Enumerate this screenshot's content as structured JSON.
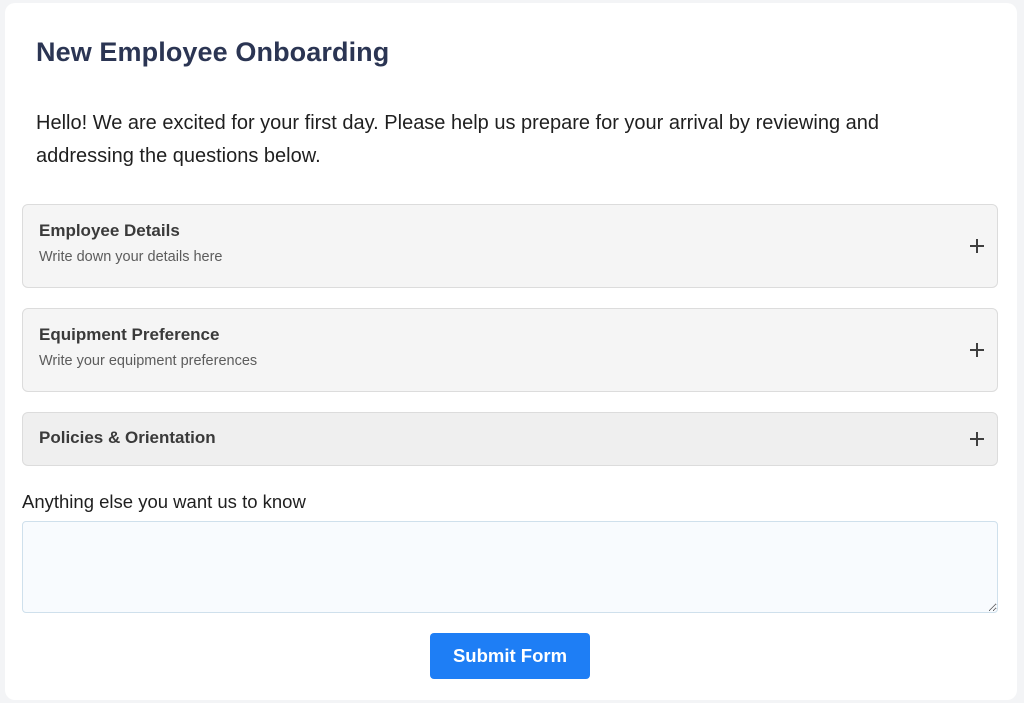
{
  "form": {
    "title": "New Employee Onboarding",
    "intro": "Hello! We are excited for your first day. Please help us prepare for your arrival by reviewing and addressing the questions below."
  },
  "sections": [
    {
      "title": "Employee Details",
      "subtitle": "Write down your details here",
      "icon": "plus-icon"
    },
    {
      "title": "Equipment Preference",
      "subtitle": "Write your equipment preferences",
      "icon": "plus-icon"
    },
    {
      "title": "Policies & Orientation",
      "icon": "plus-icon"
    }
  ],
  "extra": {
    "label": "Anything else you want us to know",
    "value": ""
  },
  "submit": {
    "label": "Submit Form"
  },
  "colors": {
    "primary": "#1e7ef5",
    "title": "#2b3553",
    "section_bg": "#f5f5f5"
  }
}
